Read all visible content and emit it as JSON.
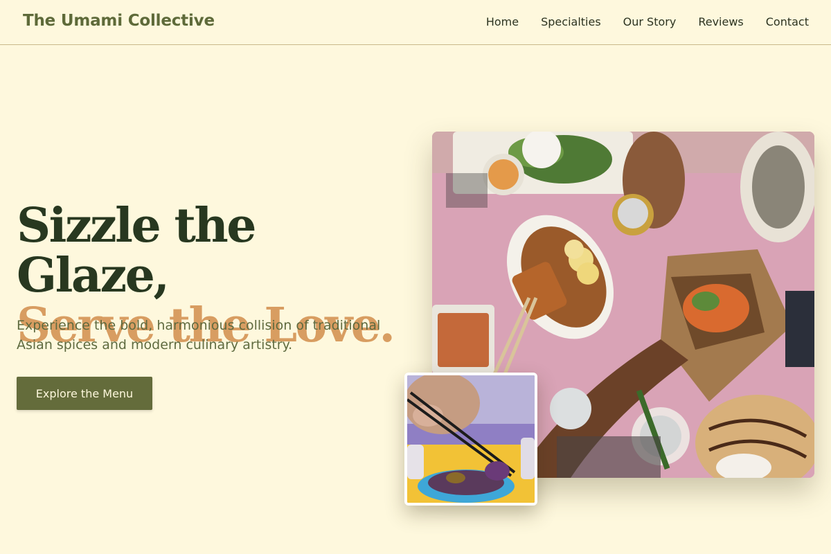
{
  "brand": {
    "name": "The Umami Collective"
  },
  "nav": {
    "items": [
      {
        "label": "Home"
      },
      {
        "label": "Specialties"
      },
      {
        "label": "Our Story"
      },
      {
        "label": "Reviews"
      },
      {
        "label": "Contact"
      }
    ]
  },
  "hero": {
    "headline_line1": "Sizzle the Glaze,",
    "headline_line2": "Serve the Love.",
    "subtitle": "Experience the bold, harmonious collision of traditional Asian spices and modern culinary artistry.",
    "cta_label": "Explore the Menu"
  },
  "colors": {
    "background": "#fef8dd",
    "brand_green": "#5e6a39",
    "headline_dark": "#283820",
    "headline_accent": "#d89d61",
    "button": "#646c3b"
  }
}
